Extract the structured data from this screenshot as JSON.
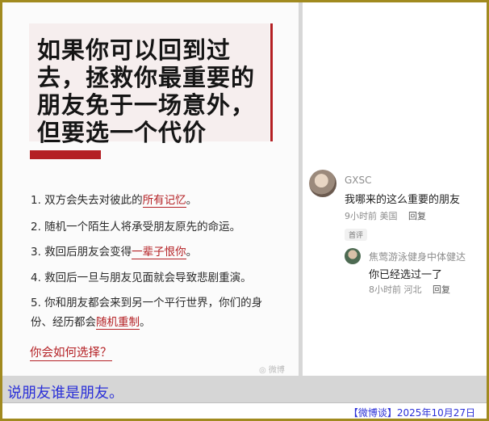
{
  "card": {
    "title_lines": [
      "如果你可以回到过",
      "去，拯救你最重要的",
      "朋友免于一场意外，",
      "但要选一个代价"
    ],
    "options": [
      {
        "pre": "1. 双方会失去对彼此的",
        "hl": "所有记忆",
        "post": "。"
      },
      {
        "pre": "2. 随机一个陌生人将承受朋友原先的命运。",
        "hl": "",
        "post": ""
      },
      {
        "pre": "3. 救回后朋友会变得",
        "hl": "一辈子恨你",
        "post": "。"
      },
      {
        "pre": "4. 救回后一旦与朋友见面就会导致悲剧重演。",
        "hl": "",
        "post": ""
      },
      {
        "line1": "5. 你和朋友都会来到另一个平行世界，你们的身",
        "pre": "份、经历都会",
        "hl": "随机重制",
        "post": "。"
      }
    ],
    "question": "你会如何选择？",
    "watermark": "微博"
  },
  "comments": [
    {
      "name": "GXSC",
      "text": "我哪来的这么重要的朋友",
      "time": "9小时前",
      "location": "美国",
      "reply": "回复",
      "tag": "首评"
    },
    {
      "name": "焦莺游泳健身中体健达",
      "text": "你已经选过一了",
      "time": "8小时前",
      "location": "河北",
      "reply": "回复"
    }
  ],
  "caption": "说朋友谁是朋友。",
  "footer": "【微博谈】2025年10月27日",
  "colors": {
    "accent_red": "#b42024",
    "caption_blue": "#2b30d8",
    "border_gold": "#a18a1f"
  }
}
